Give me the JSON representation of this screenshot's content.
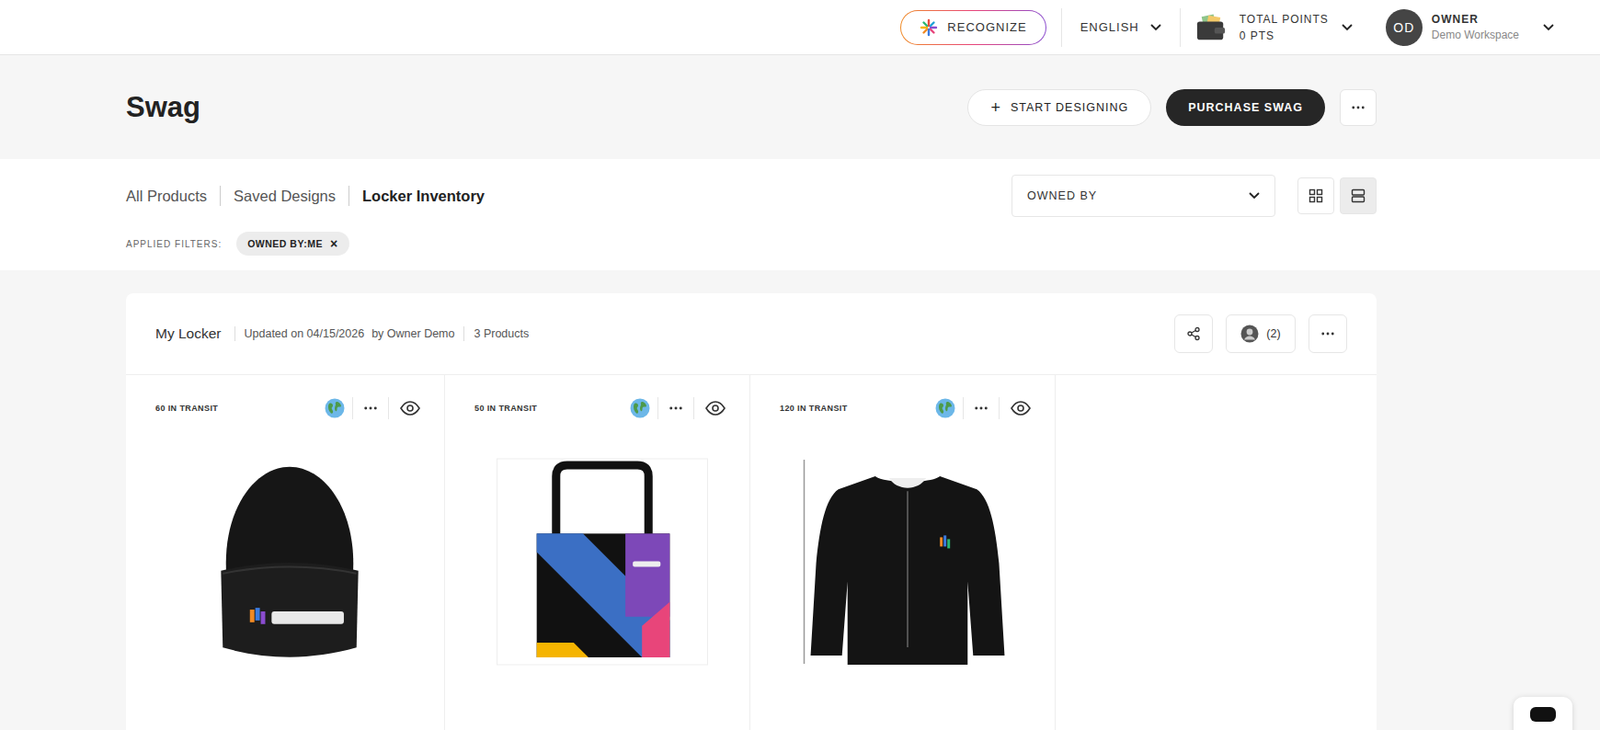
{
  "topbar": {
    "recognize": "RECOGNIZE",
    "language": "ENGLISH",
    "points_label": "TOTAL POINTS",
    "points": "0 PTS",
    "avatar": "OD",
    "user_role": "OWNER",
    "workspace": "Demo Workspace"
  },
  "page": {
    "title": "Swag",
    "start_icon": "+",
    "start": "START DESIGNING",
    "purchase": "PURCHASE SWAG"
  },
  "tabs": [
    {
      "label": "All Products",
      "selected": false
    },
    {
      "label": "Saved Designs",
      "selected": false
    },
    {
      "label": "Locker Inventory",
      "selected": true
    }
  ],
  "owned_by": {
    "label": "OWNED BY"
  },
  "views": [
    {
      "kind": "grid",
      "selected": false
    },
    {
      "kind": "list",
      "selected": true
    }
  ],
  "filters": {
    "label": "APPLIED FILTERS:",
    "chips": [
      {
        "label": "OWNED BY:ME",
        "remove": "×"
      }
    ]
  },
  "locker": {
    "name": "My Locker",
    "updated": "Updated on 04/15/2026",
    "by": "by Owner Demo",
    "count": "3 Products",
    "members": "(2)"
  },
  "products": [
    {
      "status": "60 IN TRANSIT",
      "kind": "beanie"
    },
    {
      "status": "50 IN TRANSIT",
      "kind": "tote"
    },
    {
      "status": "120 IN TRANSIT",
      "kind": "jacket"
    }
  ]
}
